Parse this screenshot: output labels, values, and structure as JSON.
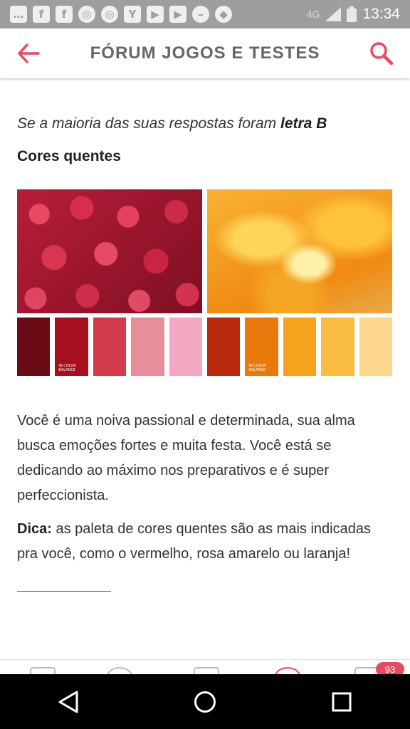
{
  "status_bar": {
    "network": "4G",
    "time": "13:34",
    "notification_icons": [
      "chat-icon",
      "facebook-icon",
      "facebook-icon",
      "chrome-icon",
      "chrome-icon",
      "yahoo-icon",
      "youtube-icon",
      "youtube-icon",
      "dnd-icon",
      "wifi-icon"
    ]
  },
  "app_bar": {
    "title": "FÓRUM JOGOS E TESTES",
    "accent_color": "#e84a5f"
  },
  "content": {
    "intro_text": "Se a maioria das suas respostas foram ",
    "intro_bold": "letra B",
    "subheading": "Cores quentes",
    "palette_swatches_left": [
      "#6a0a15",
      "#a50f1e",
      "#d23a4a",
      "#e78e9b",
      "#f3a9c3"
    ],
    "palette_swatches_right": [
      "#b7280d",
      "#e8790a",
      "#f6a21c",
      "#fbbc44",
      "#fdd78e"
    ],
    "watermark": "IN COLOR BALANCE",
    "paragraph": "Você é uma noiva passional e determinada, sua alma busca emoções fortes e muita festa. Você está se dedicando ao máximo nos preparativos e é super perfeccionista.",
    "tip_label": "Dica:",
    "tip_text": " as paleta de cores quentes são as mais indicadas pra você, como o vermelho, rosa amarelo ou laranja!"
  },
  "tab_bar": {
    "badge_count": "93"
  }
}
